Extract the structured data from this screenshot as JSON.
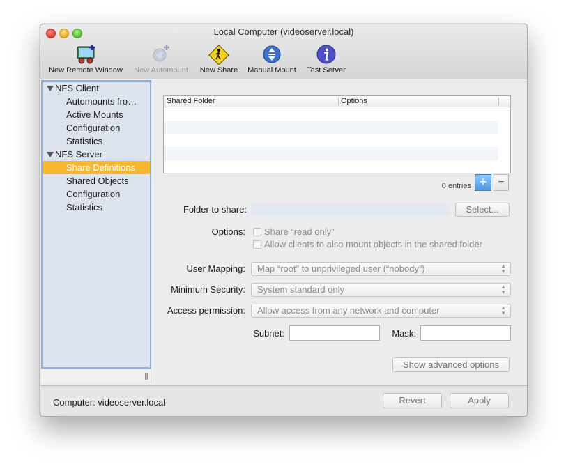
{
  "window": {
    "title": "Local Computer (videoserver.local)"
  },
  "toolbar": {
    "items": [
      {
        "label": "New Remote Window",
        "icon": "remote-window-icon",
        "enabled": true
      },
      {
        "label": "New Automount",
        "icon": "automount-icon",
        "enabled": false
      },
      {
        "label": "New Share",
        "icon": "share-sign-icon",
        "enabled": true
      },
      {
        "label": "Manual Mount",
        "icon": "mount-arrows-icon",
        "enabled": true
      },
      {
        "label": "Test Server",
        "icon": "info-icon",
        "enabled": true
      }
    ]
  },
  "sidebar": {
    "groups": [
      {
        "label": "NFS Client",
        "items": [
          "Automounts fro…",
          "Active Mounts",
          "Configuration",
          "Statistics"
        ]
      },
      {
        "label": "NFS Server",
        "items": [
          "Share Definitions",
          "Shared Objects",
          "Configuration",
          "Statistics"
        ]
      }
    ],
    "selected": "Share Definitions",
    "grip": "|||"
  },
  "share_table": {
    "columns": [
      "Shared Folder",
      "Options"
    ],
    "rows": [],
    "entries_text": "0 entries",
    "add_label": "+",
    "remove_label": "−"
  },
  "form": {
    "folder_label": "Folder to share:",
    "folder_value": "",
    "select_button": "Select...",
    "options_label": "Options:",
    "option_read_only": "Share “read only”",
    "option_allow_subfolders": "Allow clients to also mount objects in the shared folder",
    "user_mapping_label": "User Mapping:",
    "user_mapping_value": "Map “root” to unprivileged user (“nobody”)",
    "min_security_label": "Minimum Security:",
    "min_security_value": "System standard only",
    "access_label": "Access permission:",
    "access_value": "Allow access from any network and computer",
    "subnet_label": "Subnet:",
    "subnet_value": "",
    "mask_label": "Mask:",
    "mask_value": "",
    "advanced_button": "Show advanced options"
  },
  "footer": {
    "computer_label": "Computer: videoserver.local",
    "revert_button": "Revert",
    "apply_button": "Apply"
  },
  "colors": {
    "selection": "#f7b731",
    "sidebar_bg": "#dde3ec",
    "accent_blue": "#4c98e6"
  }
}
